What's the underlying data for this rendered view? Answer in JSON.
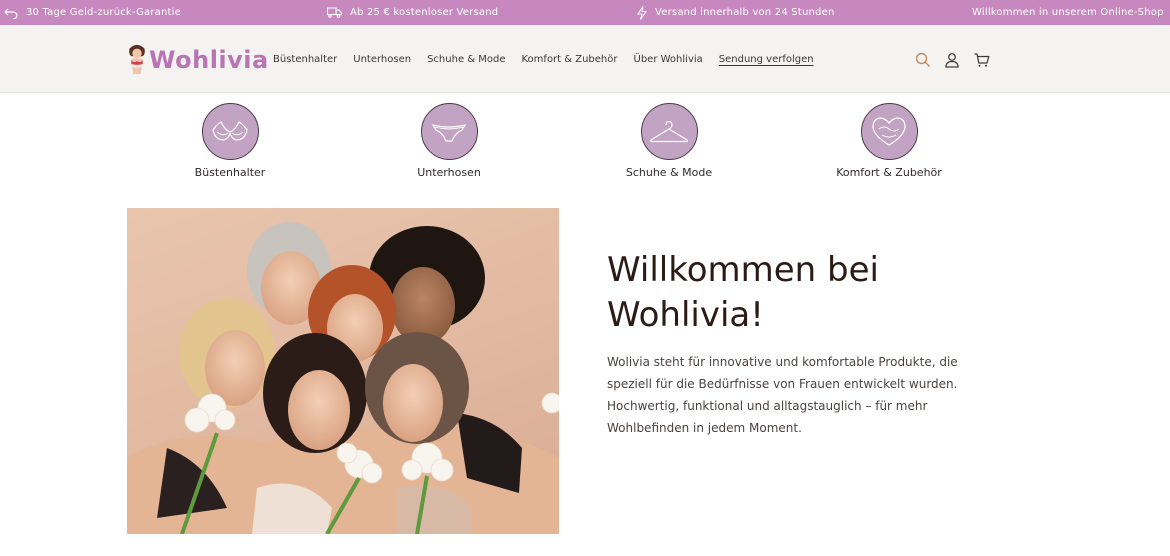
{
  "topbar": {
    "guarantee": "30 Tage Geld-zurück-Garantie",
    "shipping": "Ab 25 € kostenloser Versand",
    "fast": "Versand innerhalb von 24 Stunden",
    "welcome": "Willkommen in unserem Online-Shop"
  },
  "brand": {
    "name": "Wohlivia",
    "color": "#b974b4"
  },
  "nav": [
    "Büstenhalter",
    "Unterhosen",
    "Schuhe & Mode",
    "Komfort & Zubehör",
    "Über Wohlivia",
    "Sendung verfolgen"
  ],
  "header_icons": [
    "search-icon",
    "account-icon",
    "cart-icon"
  ],
  "categories": [
    {
      "label": "Büstenhalter",
      "icon": "bra-icon"
    },
    {
      "label": "Unterhosen",
      "icon": "underwear-icon"
    },
    {
      "label": "Schuhe & Mode",
      "icon": "hanger-icon"
    },
    {
      "label": "Komfort & Zubehör",
      "icon": "heart-icon"
    }
  ],
  "hero": {
    "title": "Willkommen bei Wohlivia!",
    "text": "Wolivia steht für innovative und komfortable Produkte, die speziell für die Bedürfnisse von Frauen entwickelt wurden. Hochwertig, funktional und alltagstauglich – für mehr Wohlbefinden in jedem Moment.",
    "image_alt": "group-of-women-photo"
  },
  "colors": {
    "topbar": "#c788bf",
    "circle": "#c3a3c4",
    "accent_icon": "#c28a5e"
  }
}
